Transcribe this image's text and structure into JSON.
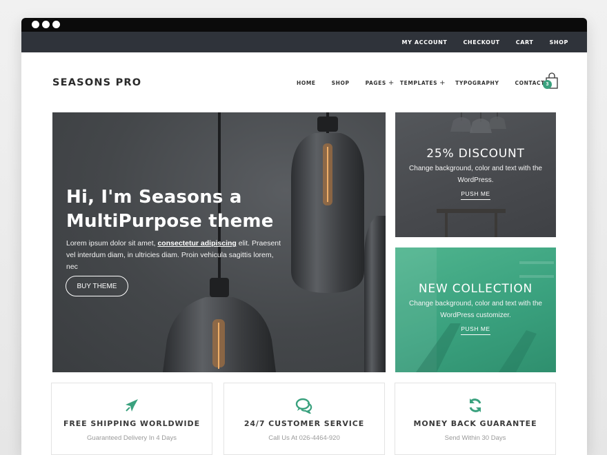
{
  "topbar": {
    "links": [
      "MY ACCOUNT",
      "CHECKOUT",
      "CART",
      "SHOP"
    ]
  },
  "header": {
    "logo": "SEASONS PRO",
    "nav": [
      {
        "label": "HOME",
        "has_submenu": false
      },
      {
        "label": "SHOP",
        "has_submenu": false
      },
      {
        "label": "PAGES",
        "has_submenu": true
      },
      {
        "label": "TEMPLATES",
        "has_submenu": true
      },
      {
        "label": "TYPOGRAPHY",
        "has_submenu": false
      },
      {
        "label": "CONTACT",
        "has_submenu": false
      }
    ],
    "submenu_symbol": "+",
    "cart_icon": "shopping-bag-icon",
    "cart_count": "3"
  },
  "hero": {
    "title": "Hi, I'm Seasons a MultiPurpose theme",
    "text_before": "Lorem ipsum dolor sit amet, ",
    "text_link": "consectetur adipiscing",
    "text_after": " elit. Praesent vel interdum diam, in ultricies diam. Proin vehicula sagittis lorem, nec",
    "button": "BUY THEME"
  },
  "promos": [
    {
      "title": "25% DISCOUNT",
      "text": "Change background, color and text with the WordPress.",
      "link": "PUSH ME"
    },
    {
      "title": "NEW COLLECTION",
      "text": "Change background, color and text with the WordPress customizer.",
      "link": "PUSH ME"
    }
  ],
  "features": [
    {
      "icon": "airplane-icon",
      "title": "FREE SHIPPING WORLDWIDE",
      "subtitle": "Guaranteed Delivery In 4 Days"
    },
    {
      "icon": "chat-bubbles-icon",
      "title": "24/7 CUSTOMER SERVICE",
      "subtitle": "Call Us At 026-4464-920"
    },
    {
      "icon": "refresh-icon",
      "title": "MONEY BACK GUARANTEE",
      "subtitle": "Send Within 30 Days"
    }
  ],
  "colors": {
    "accent": "#3aa17e",
    "topbar": "#2f333a",
    "titlebar": "#0b0b0b"
  }
}
